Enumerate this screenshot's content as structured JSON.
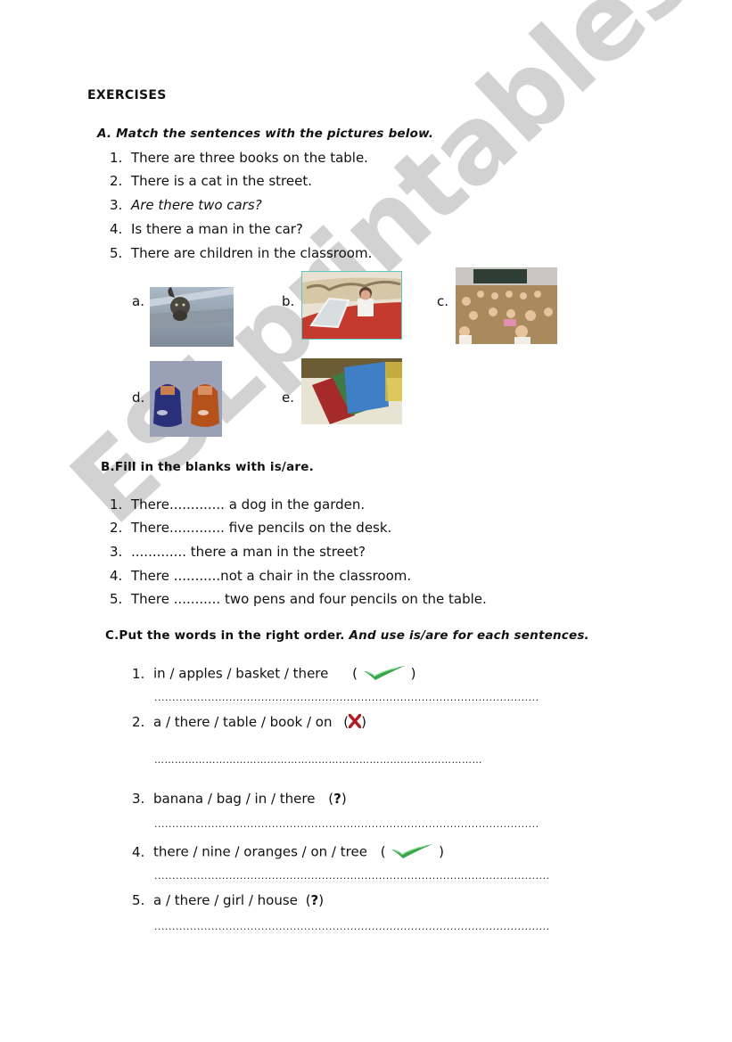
{
  "watermark": "ESLprintables.com",
  "title": "EXERCISES",
  "section_a": {
    "heading": "A. Match the sentences with the pictures below.",
    "items": [
      {
        "num": "1.",
        "text": "There are three books on the table."
      },
      {
        "num": "2.",
        "text": "There is a cat in the street."
      },
      {
        "num": "3.",
        "text": "Are there two cars?"
      },
      {
        "num": "4.",
        "text": "Is there a man in the car?"
      },
      {
        "num": "5.",
        "text": "There are children in the classroom."
      }
    ],
    "pictures": [
      {
        "label": "a.",
        "subject": "cat in the street"
      },
      {
        "label": "b.",
        "subject": "man in a red car"
      },
      {
        "label": "c.",
        "subject": "children in the classroom"
      },
      {
        "label": "d.",
        "subject": "two toy cars"
      },
      {
        "label": "e.",
        "subject": "books on the table"
      }
    ]
  },
  "section_b": {
    "heading": "B.Fill in the blanks with  is/are.",
    "items": [
      {
        "num": "1.",
        "text": "There............. a dog in the garden."
      },
      {
        "num": "2.",
        "text": "There............. five pencils on the desk."
      },
      {
        "num": "3.",
        "text": "............. there a man in the street?"
      },
      {
        "num": "4.",
        "text": "There ...........not a chair in the classroom."
      },
      {
        "num": "5.",
        "text": "There ........... two  pens and four pencils on the table."
      }
    ]
  },
  "section_c": {
    "heading_plain": "C.Put the words in the right order.",
    "heading_italic": "And use is/are for each sentences.",
    "items": [
      {
        "num": "1.",
        "text": "in / apples / basket / there",
        "open": "(",
        "close": ")",
        "icon": "check-icon",
        "answer_line": "............................................................................................................"
      },
      {
        "num": "2.",
        "text": "a / there / table / book / on",
        "open": "(",
        "close": ")",
        "icon": "cross-icon",
        "answer_line": "……………………………………………………………………………………"
      },
      {
        "num": "3.",
        "text": "banana / bag / in / there",
        "open": "(",
        "close": ")",
        "icon": "question-mark",
        "symbol": "?",
        "answer_line": "............................................................................................................"
      },
      {
        "num": "4.",
        "text": "there / nine / oranges / on / tree",
        "open": "(",
        "close": ")",
        "icon": "check-icon",
        "answer_line": "..............................................................................................................."
      },
      {
        "num": "5.",
        "text": "a / there / girl / house",
        "open": "(",
        "close": ")",
        "icon": "question-mark",
        "symbol": "?",
        "answer_line": "..............................................................................................................."
      }
    ]
  },
  "colors": {
    "check_green": "#3aa64a",
    "cross_red": "#b01c22",
    "watermark_gray": "#d2d2d2",
    "frame_teal": "#5fc7bd"
  }
}
